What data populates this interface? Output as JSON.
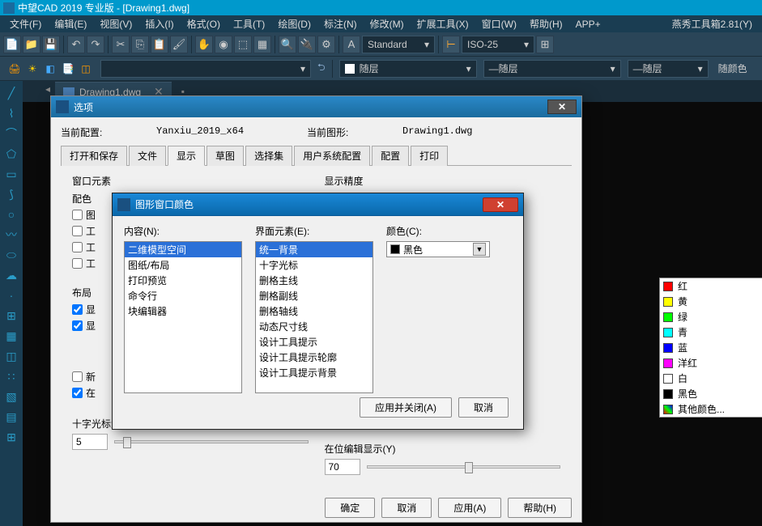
{
  "app": {
    "title": "中望CAD 2019 专业版 - [Drawing1.dwg]"
  },
  "menu": [
    "文件(F)",
    "编辑(E)",
    "视图(V)",
    "插入(I)",
    "格式(O)",
    "工具(T)",
    "绘图(D)",
    "标注(N)",
    "修改(M)",
    "扩展工具(X)",
    "窗口(W)",
    "帮助(H)",
    "APP+"
  ],
  "menu_right": "燕秀工具箱2.81(Y)",
  "style_dropdown1": "Standard",
  "style_dropdown2": "ISO-25",
  "layer_dropdown": "随层",
  "color_dropdown_label": "随颜色",
  "doc_tab": "Drawing1.dwg",
  "options_dialog": {
    "title": "选项",
    "current_config_label": "当前配置:",
    "current_config_value": "Yanxiu_2019_x64",
    "current_drawing_label": "当前图形:",
    "current_drawing_value": "Drawing1.dwg",
    "tabs": [
      "打开和保存",
      "文件",
      "显示",
      "草图",
      "选择集",
      "用户系统配置",
      "配置",
      "打印"
    ],
    "active_tab": "显示",
    "window_elements_label": "窗口元素",
    "display_precision_label": "显示精度",
    "peise_label": "配色",
    "layout_label": "布局",
    "chk_xian": "显",
    "chk_xin": "新",
    "chk_zai": "在",
    "cross_label": "十字光标大小",
    "cross_value": "5",
    "inplace_label": "在位编辑显示(Y)",
    "inplace_value": "70",
    "buttons": {
      "ok": "确定",
      "cancel": "取消",
      "apply": "应用(A)",
      "help": "帮助(H)"
    }
  },
  "color_dialog": {
    "title": "图形窗口颜色",
    "content_label": "内容(N):",
    "content_items": [
      "二维模型空间",
      "图纸/布局",
      "打印预览",
      "命令行",
      "块编辑器"
    ],
    "ui_label": "界面元素(E):",
    "ui_items": [
      "统一背景",
      "十字光标",
      "删格主线",
      "删格副线",
      "删格轴线",
      "动态尺寸线",
      "设计工具提示",
      "设计工具提示轮廓",
      "设计工具提示背景"
    ],
    "color_label": "颜色(C):",
    "color_selected": "黑色",
    "colors": [
      {
        "name": "红",
        "hex": "#ff0000"
      },
      {
        "name": "黄",
        "hex": "#ffff00"
      },
      {
        "name": "绿",
        "hex": "#00ff00"
      },
      {
        "name": "青",
        "hex": "#00ffff"
      },
      {
        "name": "蓝",
        "hex": "#0000ff"
      },
      {
        "name": "洋红",
        "hex": "#ff00ff"
      },
      {
        "name": "白",
        "hex": "#ffffff"
      },
      {
        "name": "黑色",
        "hex": "#000000"
      },
      {
        "name": "其他颜色...",
        "hex": "#808080"
      }
    ],
    "apply_close": "应用并关闭(A)",
    "cancel": "取消"
  }
}
